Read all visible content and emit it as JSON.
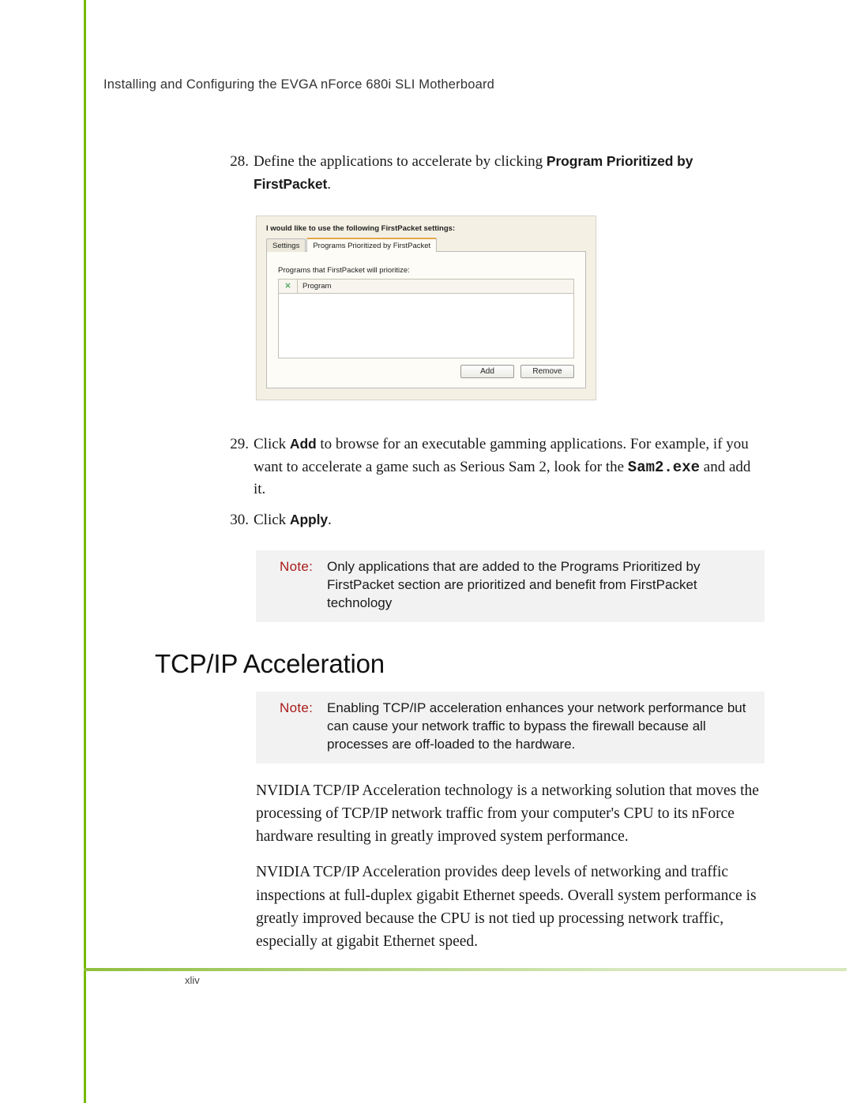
{
  "header": {
    "title": "Installing and Configuring the EVGA nForce 680i SLI Motherboard"
  },
  "steps": {
    "s28": {
      "num": "28.",
      "prefix": "Define the applications to accelerate by clicking ",
      "ui": "Program Prioritized by FirstPacket",
      "suffix": "."
    },
    "s29": {
      "num": "29.",
      "prefix": "Click ",
      "ui": "Add",
      "mid": " to browse for an executable gamming applications. For example, if you want to accelerate a game such as Serious Sam 2, look for the ",
      "mono": "Sam2.exe",
      "suffix": " and add it."
    },
    "s30": {
      "num": "30.",
      "prefix": "Click ",
      "ui": "Apply",
      "suffix": "."
    }
  },
  "screenshot": {
    "heading": "I would like to use the following FirstPacket settings:",
    "tabs": {
      "settings": "Settings",
      "programs": "Programs Prioritized by FirstPacket"
    },
    "panel_label": "Programs that FirstPacket will prioritize:",
    "cols": {
      "x": "✕",
      "program": "Program"
    },
    "buttons": {
      "add": "Add",
      "remove": "Remove"
    }
  },
  "notes": {
    "label1": "Note:",
    "text1": "Only applications that are added to the Programs Prioritized by FirstPacket section are prioritized and benefit from FirstPacket technology",
    "label2": "Note:",
    "text2": "Enabling TCP/IP acceleration enhances your network performance but can cause your network traffic to bypass the firewall because all processes are off-loaded to the hardware."
  },
  "section": {
    "heading": "TCP/IP Acceleration"
  },
  "paras": {
    "p1": "NVIDIA TCP/IP Acceleration technology is a networking solution that moves the processing of TCP/IP network traffic from your computer's CPU to its nForce hardware resulting in greatly improved system performance.",
    "p2": "NVIDIA TCP/IP Acceleration provides deep levels of networking and traffic inspections at full-duplex gigabit Ethernet speeds. Overall system performance is greatly improved because the CPU is not tied up processing network traffic, especially at gigabit Ethernet speed."
  },
  "footer": {
    "page": "xliv"
  }
}
